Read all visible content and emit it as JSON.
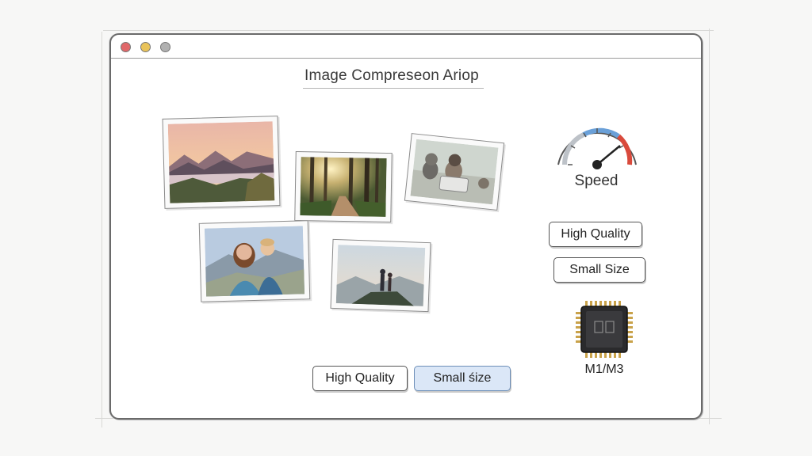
{
  "window": {
    "title": "Image Compreseon Ariop",
    "controls": [
      "close",
      "minimize",
      "zoom"
    ]
  },
  "photos": [
    {
      "subject": "mountain-lake-sunset-icon"
    },
    {
      "subject": "forest-path-sunlight-icon"
    },
    {
      "subject": "pets-animals-icon"
    },
    {
      "subject": "family-portrait-icon"
    },
    {
      "subject": "hikers-summit-icon"
    }
  ],
  "speed": {
    "label": "Speed",
    "colors": {
      "low": "#9aa0a8",
      "mid": "#6aa0d8",
      "high": "#d94a3c"
    }
  },
  "side_options": {
    "high_quality": "High Quality",
    "small_size": "Small Size"
  },
  "chip": {
    "label": "M1/M3",
    "icon": "processor-chip-icon"
  },
  "bottom_options": {
    "high_quality": "High Quality",
    "small_size": "Small śize",
    "selected": "small_size",
    "accent": "#dbe7f7"
  }
}
